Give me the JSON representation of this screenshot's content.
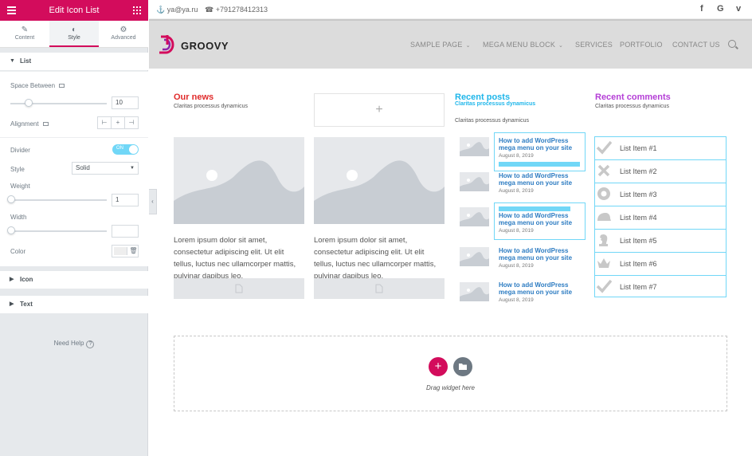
{
  "panel": {
    "title": "Edit Icon List",
    "tabs": [
      {
        "label": "Content",
        "icon": "pencil-icon"
      },
      {
        "label": "Style",
        "icon": "contrast-icon"
      },
      {
        "label": "Advanced",
        "icon": "gear-icon"
      }
    ],
    "sections": {
      "list": "List",
      "icon": "Icon",
      "text": "Text"
    },
    "controls": {
      "space_between_label": "Space Between",
      "space_between_value": "10",
      "space_between_fraction": 0.2,
      "alignment_label": "Alignment",
      "divider_label": "Divider",
      "divider_state": "ON",
      "style_label": "Style",
      "style_value": "Solid",
      "weight_label": "Weight",
      "weight_value": "1",
      "weight_fraction": 0.0,
      "width_label": "Width",
      "width_value": "",
      "width_fraction": 0.0,
      "color_label": "Color"
    },
    "need_help": "Need Help",
    "accent": "#d30c5c"
  },
  "topbar": {
    "email": "ya@ya.ru",
    "phone": "+791278412313",
    "social": [
      "f",
      "G",
      "v"
    ]
  },
  "header": {
    "logo_text": "GROOVY",
    "nav": [
      {
        "label": "SAMPLE PAGE",
        "has_dropdown": true
      },
      {
        "label": "MEGA MENU BLOCK",
        "has_dropdown": true
      },
      {
        "label": "SERVICES",
        "has_dropdown": false
      },
      {
        "label": "PORTFOLIO",
        "has_dropdown": false
      },
      {
        "label": "CONTACT US",
        "has_dropdown": false
      }
    ]
  },
  "content": {
    "our_news": {
      "title": "Our news",
      "subtitle": "Claritas processus dynamicus",
      "color": "#e02b2b"
    },
    "lorem": "Lorem ipsum dolor sit amet, consectetur adipiscing elit. Ut elit tellus, luctus nec ullamcorper mattis, pulvinar dapibus leo.",
    "plus": "+",
    "recent_posts": {
      "title": "Recent posts",
      "subtitle": "Claritas processus dynamicus",
      "subtitle2": "Claritas processus dynamicus",
      "color": "#1eb6ea",
      "posts": [
        {
          "title": "How to add WordPress mega menu on your site",
          "date": "August 8, 2019"
        },
        {
          "title": "How to add WordPress mega menu on your site",
          "date": "August 8, 2019"
        },
        {
          "title": "How to add WordPress mega menu on your site",
          "date": "August 8, 2019"
        },
        {
          "title": "How to add WordPress mega menu on your site",
          "date": "August 8, 2019"
        },
        {
          "title": "How to add WordPress mega menu on your site",
          "date": "August 8, 2019"
        }
      ]
    },
    "recent_comments": {
      "title": "Recent comments",
      "subtitle": "Claritas processus dynamicus",
      "color": "#b43ed6",
      "items": [
        {
          "label": "List Item #1",
          "icon": "check-icon"
        },
        {
          "label": "List Item #2",
          "icon": "close-icon"
        },
        {
          "label": "List Item #3",
          "icon": "circle-icon"
        },
        {
          "label": "List Item #4",
          "icon": "hat-icon"
        },
        {
          "label": "List Item #5",
          "icon": "chess-knight-icon"
        },
        {
          "label": "List Item #6",
          "icon": "crown-icon"
        },
        {
          "label": "List Item #7",
          "icon": "check-icon"
        }
      ]
    },
    "drop_zone": {
      "add": "+",
      "text": "Drag widget here"
    }
  }
}
